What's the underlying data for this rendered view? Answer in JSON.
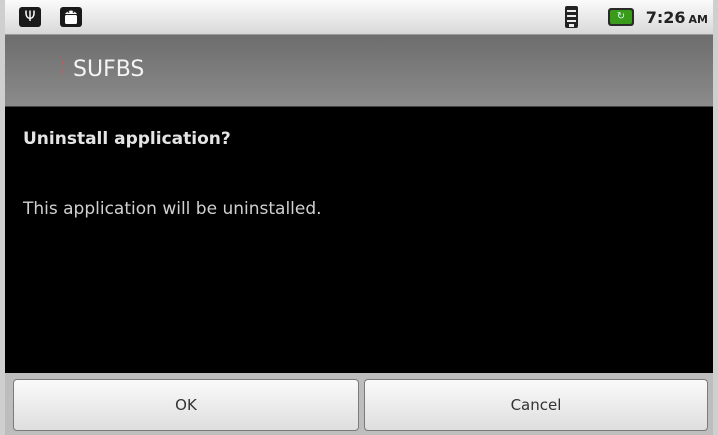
{
  "status_bar": {
    "icons": [
      "usb-icon",
      "android-icon",
      "wifi-icon",
      "battery-icon"
    ],
    "time": "7:26",
    "ampm": "AM"
  },
  "title_bar": {
    "app_name": "SUFBS",
    "logo_color": "#cc2222"
  },
  "dialog": {
    "heading": "Uninstall application?",
    "message": "This application will be uninstalled."
  },
  "buttons": {
    "ok": "OK",
    "cancel": "Cancel"
  }
}
